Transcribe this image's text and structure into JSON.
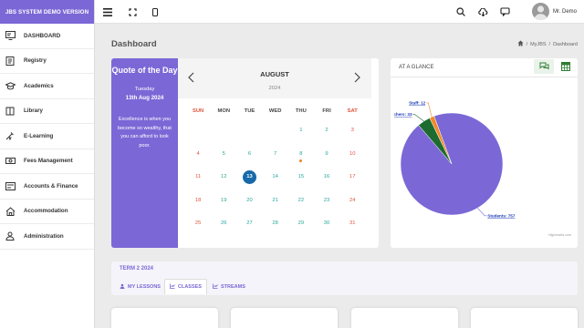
{
  "brand": "JBS SYSTEM DEMO VERSION",
  "sidebar": {
    "items": [
      {
        "label": "DASHBOARD",
        "icon": "dashboard-icon"
      },
      {
        "label": "Registry",
        "icon": "registry-icon"
      },
      {
        "label": "Academics",
        "icon": "academics-icon"
      },
      {
        "label": "Library",
        "icon": "library-icon"
      },
      {
        "label": "E-Learning",
        "icon": "elearning-icon"
      },
      {
        "label": "Fees Management",
        "icon": "fees-icon"
      },
      {
        "label": "Accounts & Finance",
        "icon": "finance-icon"
      },
      {
        "label": "Accommodation",
        "icon": "accommodation-icon"
      },
      {
        "label": "Administration",
        "icon": "administration-icon"
      }
    ]
  },
  "topbar": {
    "user_name": "Mr. Demo"
  },
  "page": {
    "title": "Dashboard"
  },
  "breadcrumb": {
    "items": [
      "MyJBS",
      "/",
      "Dashboard"
    ]
  },
  "quote": {
    "title": "Quote of the Day",
    "weekday": "Tuesday",
    "date": "13th Aug 2024",
    "text": "Excellence is when you become so wealthy, that you can afford to look poor."
  },
  "calendar": {
    "month": "AUGUST",
    "year": "2024",
    "weekdays": [
      "SUN",
      "MON",
      "TUE",
      "WED",
      "THU",
      "FRI",
      "SAT"
    ],
    "weeks": [
      [
        "",
        "",
        "",
        "",
        "1",
        "2",
        "3"
      ],
      [
        "4",
        "5",
        "6",
        "7",
        "8",
        "9",
        "10"
      ],
      [
        "11",
        "12",
        "13",
        "14",
        "15",
        "16",
        "17"
      ],
      [
        "18",
        "19",
        "20",
        "21",
        "22",
        "23",
        "24"
      ],
      [
        "25",
        "26",
        "27",
        "28",
        "29",
        "30",
        "31"
      ]
    ],
    "today": "13",
    "event_days": [
      "8"
    ],
    "colors": {
      "weekday": "#26a69a",
      "weekend": "#e0553b",
      "today": "#1769aa",
      "event_dot": "#e8862a"
    }
  },
  "glance": {
    "title": "AT A GLANCE",
    "credit": "Highcharts.com"
  },
  "chart_data": {
    "type": "pie",
    "slices": [
      {
        "label": "Students",
        "value": 757,
        "color": "#7b68d6"
      },
      {
        "label": "Teachers",
        "value": 33,
        "color": "#1e6b30"
      },
      {
        "label": "Staff",
        "value": 12,
        "color": "#f08a2a"
      }
    ],
    "data_labels": [
      "Students: 757",
      "Teachers: 33",
      "Staff: 12"
    ]
  },
  "term": {
    "title": "TERM 2 2024",
    "tabs": [
      "MY LESSONS",
      "CLASSES",
      "STREAMS"
    ],
    "active_tab": "CLASSES"
  },
  "colors": {
    "accent": "#7b68d6",
    "sidebar_bg": "#ffffff",
    "page_bg": "#ebebeb"
  }
}
